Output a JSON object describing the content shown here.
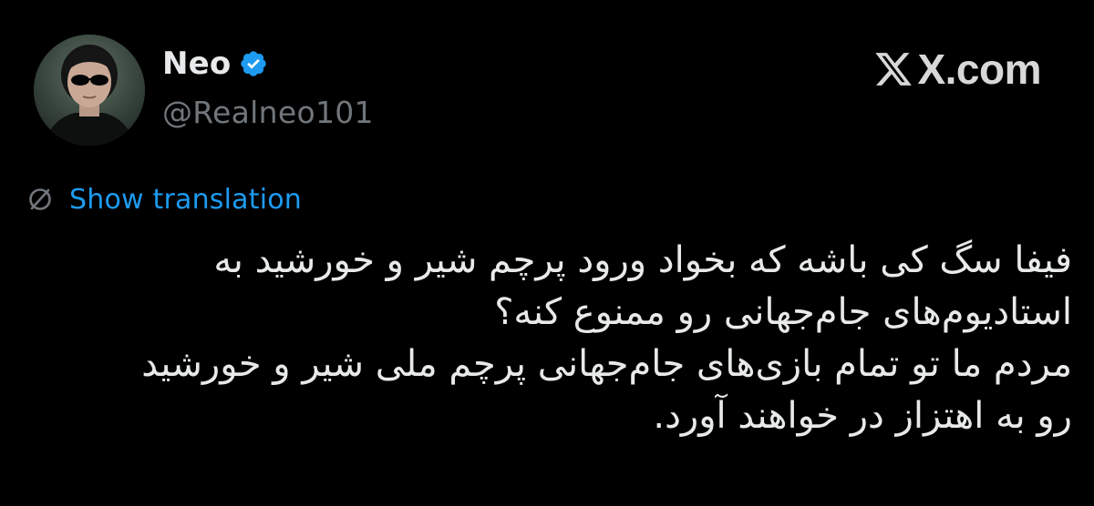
{
  "author": {
    "display_name": "Neo",
    "handle": "@Realneo101",
    "verified": true,
    "avatar_icon": "avatar-photo"
  },
  "brand": {
    "logo_icon": "x-logo-icon",
    "label": "X.com"
  },
  "translation": {
    "icon": "globe-icon",
    "label": "Show translation"
  },
  "tweet": {
    "lines": [
      "فیفا سگ کی باشه که بخواد ورود پرچم شیر و خورشید به",
      "استادیوم‌های جام‌جهانی رو ممنوع کنه؟",
      "مردم ما تو تمام بازی‌های جام‌جهانی پرچم ملی شیر و خورشید",
      "رو به اهتزاز در خواهند آورد."
    ]
  },
  "colors": {
    "background": "#000000",
    "text_primary": "#e7e9ea",
    "text_secondary": "#71767b",
    "link": "#1d9bf0",
    "verified": "#1d9bf0"
  }
}
